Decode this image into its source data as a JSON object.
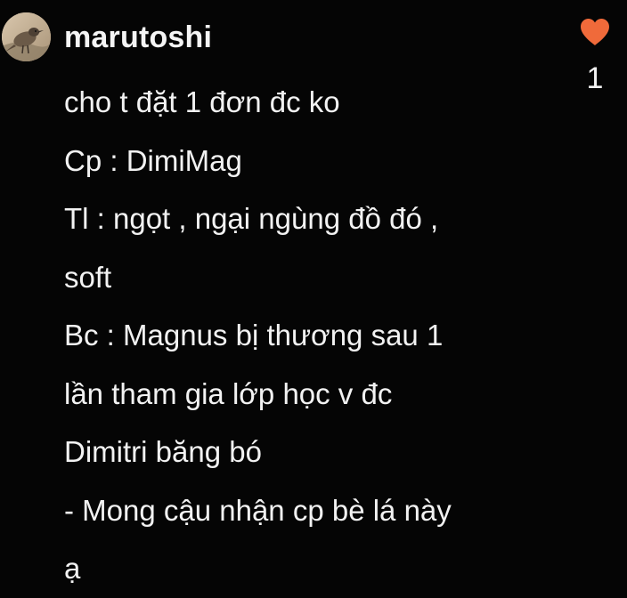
{
  "comment": {
    "username": "marutoshi",
    "lines": [
      "cho t đặt 1 đơn đc ko",
      "Cp : DimiMag",
      "Tl : ngọt , ngại ngùng đồ đó ,",
      "soft",
      "Bc : Magnus bị thương sau 1",
      "lần tham gia lớp học v đc",
      "Dimitri băng bó",
      "- Mong cậu nhận cp bè lá này",
      "ạ"
    ],
    "likes": {
      "icon": "heart-icon",
      "count": "1",
      "color": "#f06a3a"
    }
  },
  "colors": {
    "background": "#050505",
    "text": "#f2f2f2"
  }
}
